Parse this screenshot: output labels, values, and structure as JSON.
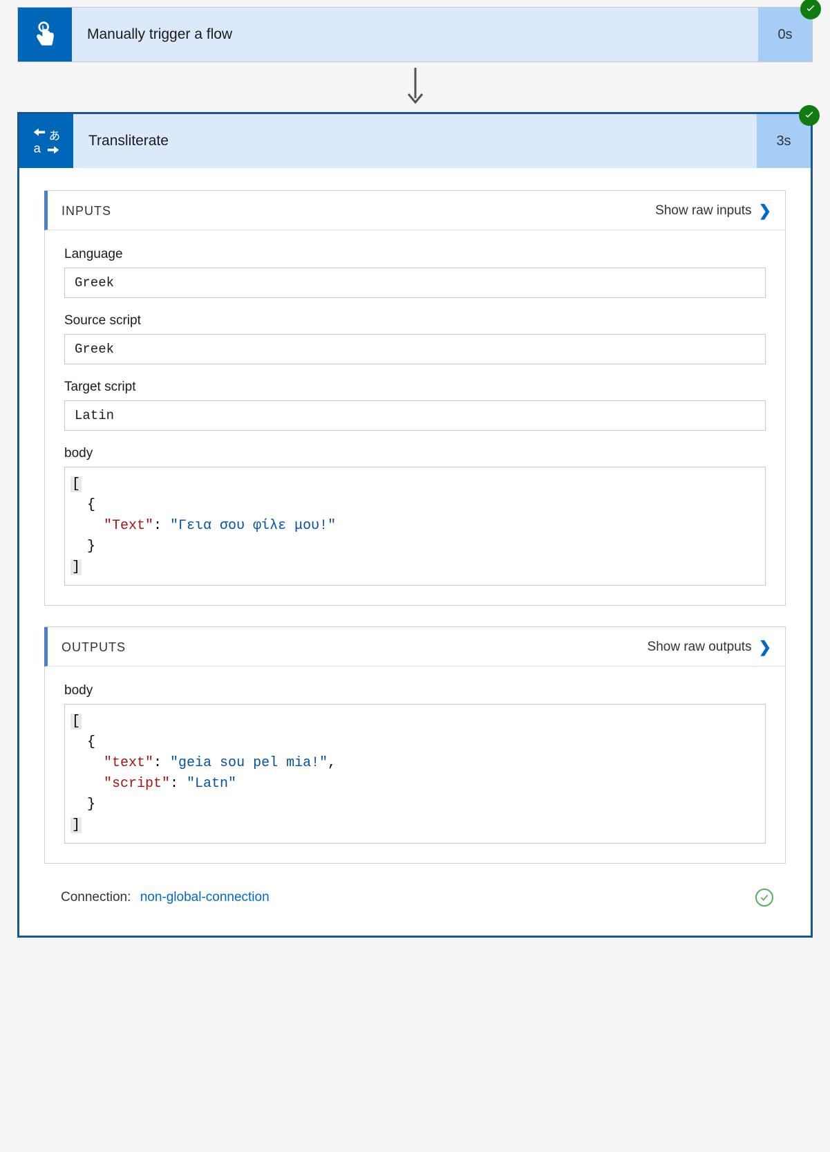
{
  "trigger": {
    "title": "Manually trigger a flow",
    "duration": "0s"
  },
  "action": {
    "title": "Transliterate",
    "duration": "3s",
    "inputs": {
      "heading": "INPUTS",
      "link": "Show raw inputs",
      "fields": {
        "language_label": "Language",
        "language_value": "Greek",
        "source_label": "Source script",
        "source_value": "Greek",
        "target_label": "Target script",
        "target_value": "Latin",
        "body_label": "body",
        "body_key": "\"Text\"",
        "body_val": "\"Γεια σου φίλε μου!\""
      }
    },
    "outputs": {
      "heading": "OUTPUTS",
      "link": "Show raw outputs",
      "body_label": "body",
      "text_key": "\"text\"",
      "text_val": "\"geia sou pel mia!\"",
      "script_key": "\"script\"",
      "script_val": "\"Latn\""
    },
    "footer": {
      "label": "Connection:",
      "link": "non-global-connection"
    }
  }
}
